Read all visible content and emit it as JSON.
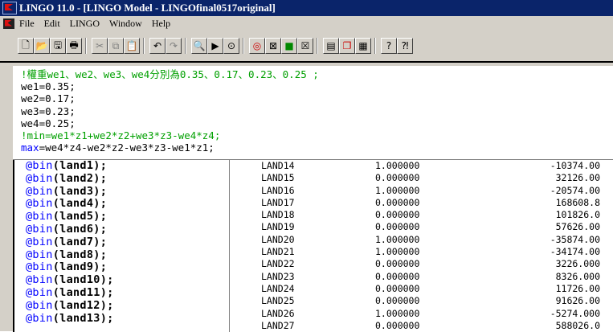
{
  "window": {
    "title": "LINGO 11.0 - [LINGO Model - LINGOfinal0517original]"
  },
  "menu": [
    "File",
    "Edit",
    "LINGO",
    "Window",
    "Help"
  ],
  "toolbar_icons": [
    "new-file-icon",
    "open-folder-icon",
    "save-icon",
    "print-icon",
    "cut-icon",
    "copy-icon",
    "paste-icon",
    "undo-icon",
    "redo-icon",
    "find-icon",
    "goto-icon",
    "match-paren-icon",
    "solve-icon",
    "solution-icon",
    "matrix-icon",
    "close-all-icon",
    "tile-icon",
    "cascade-icon",
    "send-to-back-icon",
    "help-icon",
    "context-help-icon"
  ],
  "editor": {
    "lines": [
      {
        "type": "cmt",
        "text": "!權重we1、we2、we3、we4分別為0.35、0.17、0.23、0.25 ;"
      },
      {
        "type": "def",
        "text": "we1=0.35;"
      },
      {
        "type": "def",
        "text": "we2=0.17;"
      },
      {
        "type": "def",
        "text": "we3=0.23;"
      },
      {
        "type": "def",
        "text": "we4=0.25;"
      },
      {
        "type": "cmt",
        "text": "!min=we1*z1+we2*z2+we3*z3-we4*z4;"
      },
      {
        "type": "max",
        "kw": "max",
        "text": "=we4*z4-we2*z2-we3*z3-we1*z1;"
      }
    ]
  },
  "bin_lines": [
    {
      "fn": "@bin",
      "arg": "(land1);"
    },
    {
      "fn": "@bin",
      "arg": "(land2);"
    },
    {
      "fn": "@bin",
      "arg": "(land3);"
    },
    {
      "fn": "@bin",
      "arg": "(land4);"
    },
    {
      "fn": "@bin",
      "arg": "(land5);"
    },
    {
      "fn": "@bin",
      "arg": "(land6);"
    },
    {
      "fn": "@bin",
      "arg": "(land7);"
    },
    {
      "fn": "@bin",
      "arg": "(land8);"
    },
    {
      "fn": "@bin",
      "arg": "(land9);"
    },
    {
      "fn": "@bin",
      "arg": "(land10);"
    },
    {
      "fn": "@bin",
      "arg": "(land11);"
    },
    {
      "fn": "@bin",
      "arg": "(land12);"
    },
    {
      "fn": "@bin",
      "arg": "(land13);"
    }
  ],
  "solution_rows": [
    {
      "var": "LAND14",
      "value": "1.000000",
      "cost": "-10374.00"
    },
    {
      "var": "LAND15",
      "value": "0.000000",
      "cost": "32126.00"
    },
    {
      "var": "LAND16",
      "value": "1.000000",
      "cost": "-20574.00"
    },
    {
      "var": "LAND17",
      "value": "0.000000",
      "cost": "168608.8"
    },
    {
      "var": "LAND18",
      "value": "0.000000",
      "cost": "101826.0"
    },
    {
      "var": "LAND19",
      "value": "0.000000",
      "cost": "57626.00"
    },
    {
      "var": "LAND20",
      "value": "1.000000",
      "cost": "-35874.00"
    },
    {
      "var": "LAND21",
      "value": "1.000000",
      "cost": "-34174.00"
    },
    {
      "var": "LAND22",
      "value": "0.000000",
      "cost": "3226.000"
    },
    {
      "var": "LAND23",
      "value": "0.000000",
      "cost": "8326.000"
    },
    {
      "var": "LAND24",
      "value": "0.000000",
      "cost": "11726.00"
    },
    {
      "var": "LAND25",
      "value": "0.000000",
      "cost": "91626.00"
    },
    {
      "var": "LAND26",
      "value": "1.000000",
      "cost": "-5274.000"
    },
    {
      "var": "LAND27",
      "value": "0.000000",
      "cost": "588026.0"
    }
  ]
}
